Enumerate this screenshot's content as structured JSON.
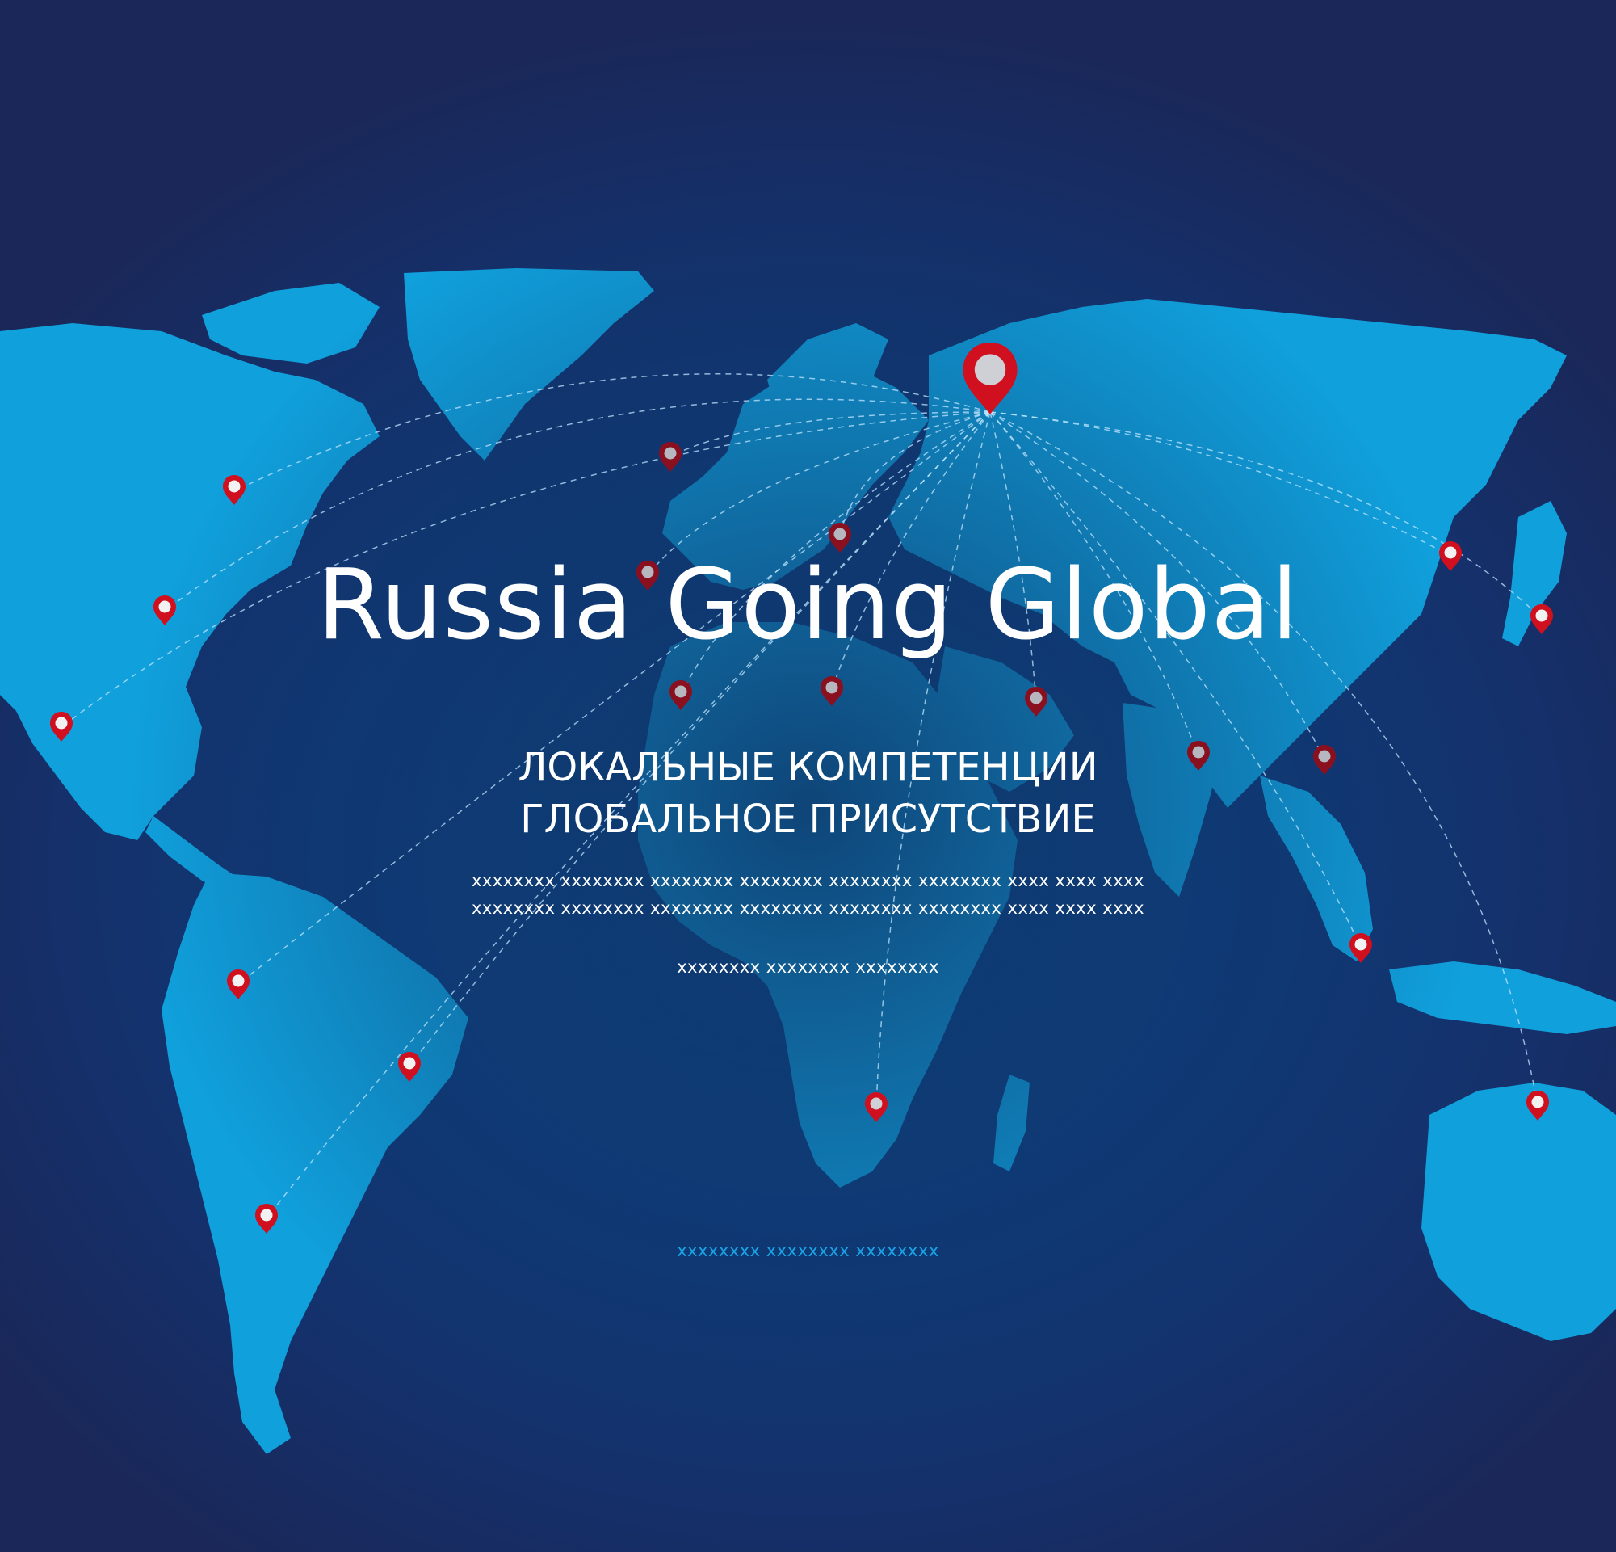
{
  "slide": {
    "title": "Russia Going Global",
    "subtitle_line1": "ЛОКАЛЬНЫЕ КОМПЕТЕНЦИИ",
    "subtitle_line2": "ГЛОБАЛЬНОЕ ПРИСУТСТВИЕ",
    "placeholder_line1": "xxxxxxxx xxxxxxxx xxxxxxxx xxxxxxxx xxxxxxxx xxxxxxxx  xxxx  xxxx  xxxx",
    "placeholder_line2": "xxxxxxxx xxxxxxxx xxxxxxxx xxxxxxxx xxxxxxxx xxxxxxxx  xxxx  xxxx  xxxx",
    "placeholder_line3": "xxxxxxxx xxxxxxxx xxxxxxxx",
    "placeholder_footer": "xxxxxxxx xxxxxxxx xxxxxxxx"
  },
  "colors": {
    "background": "#15306a",
    "continent": "#10a0dc",
    "marker": "#d0101e",
    "marker_dim": "#7a1020",
    "route": "#bfe6ff"
  },
  "icons": [
    "map-pin-icon"
  ]
}
